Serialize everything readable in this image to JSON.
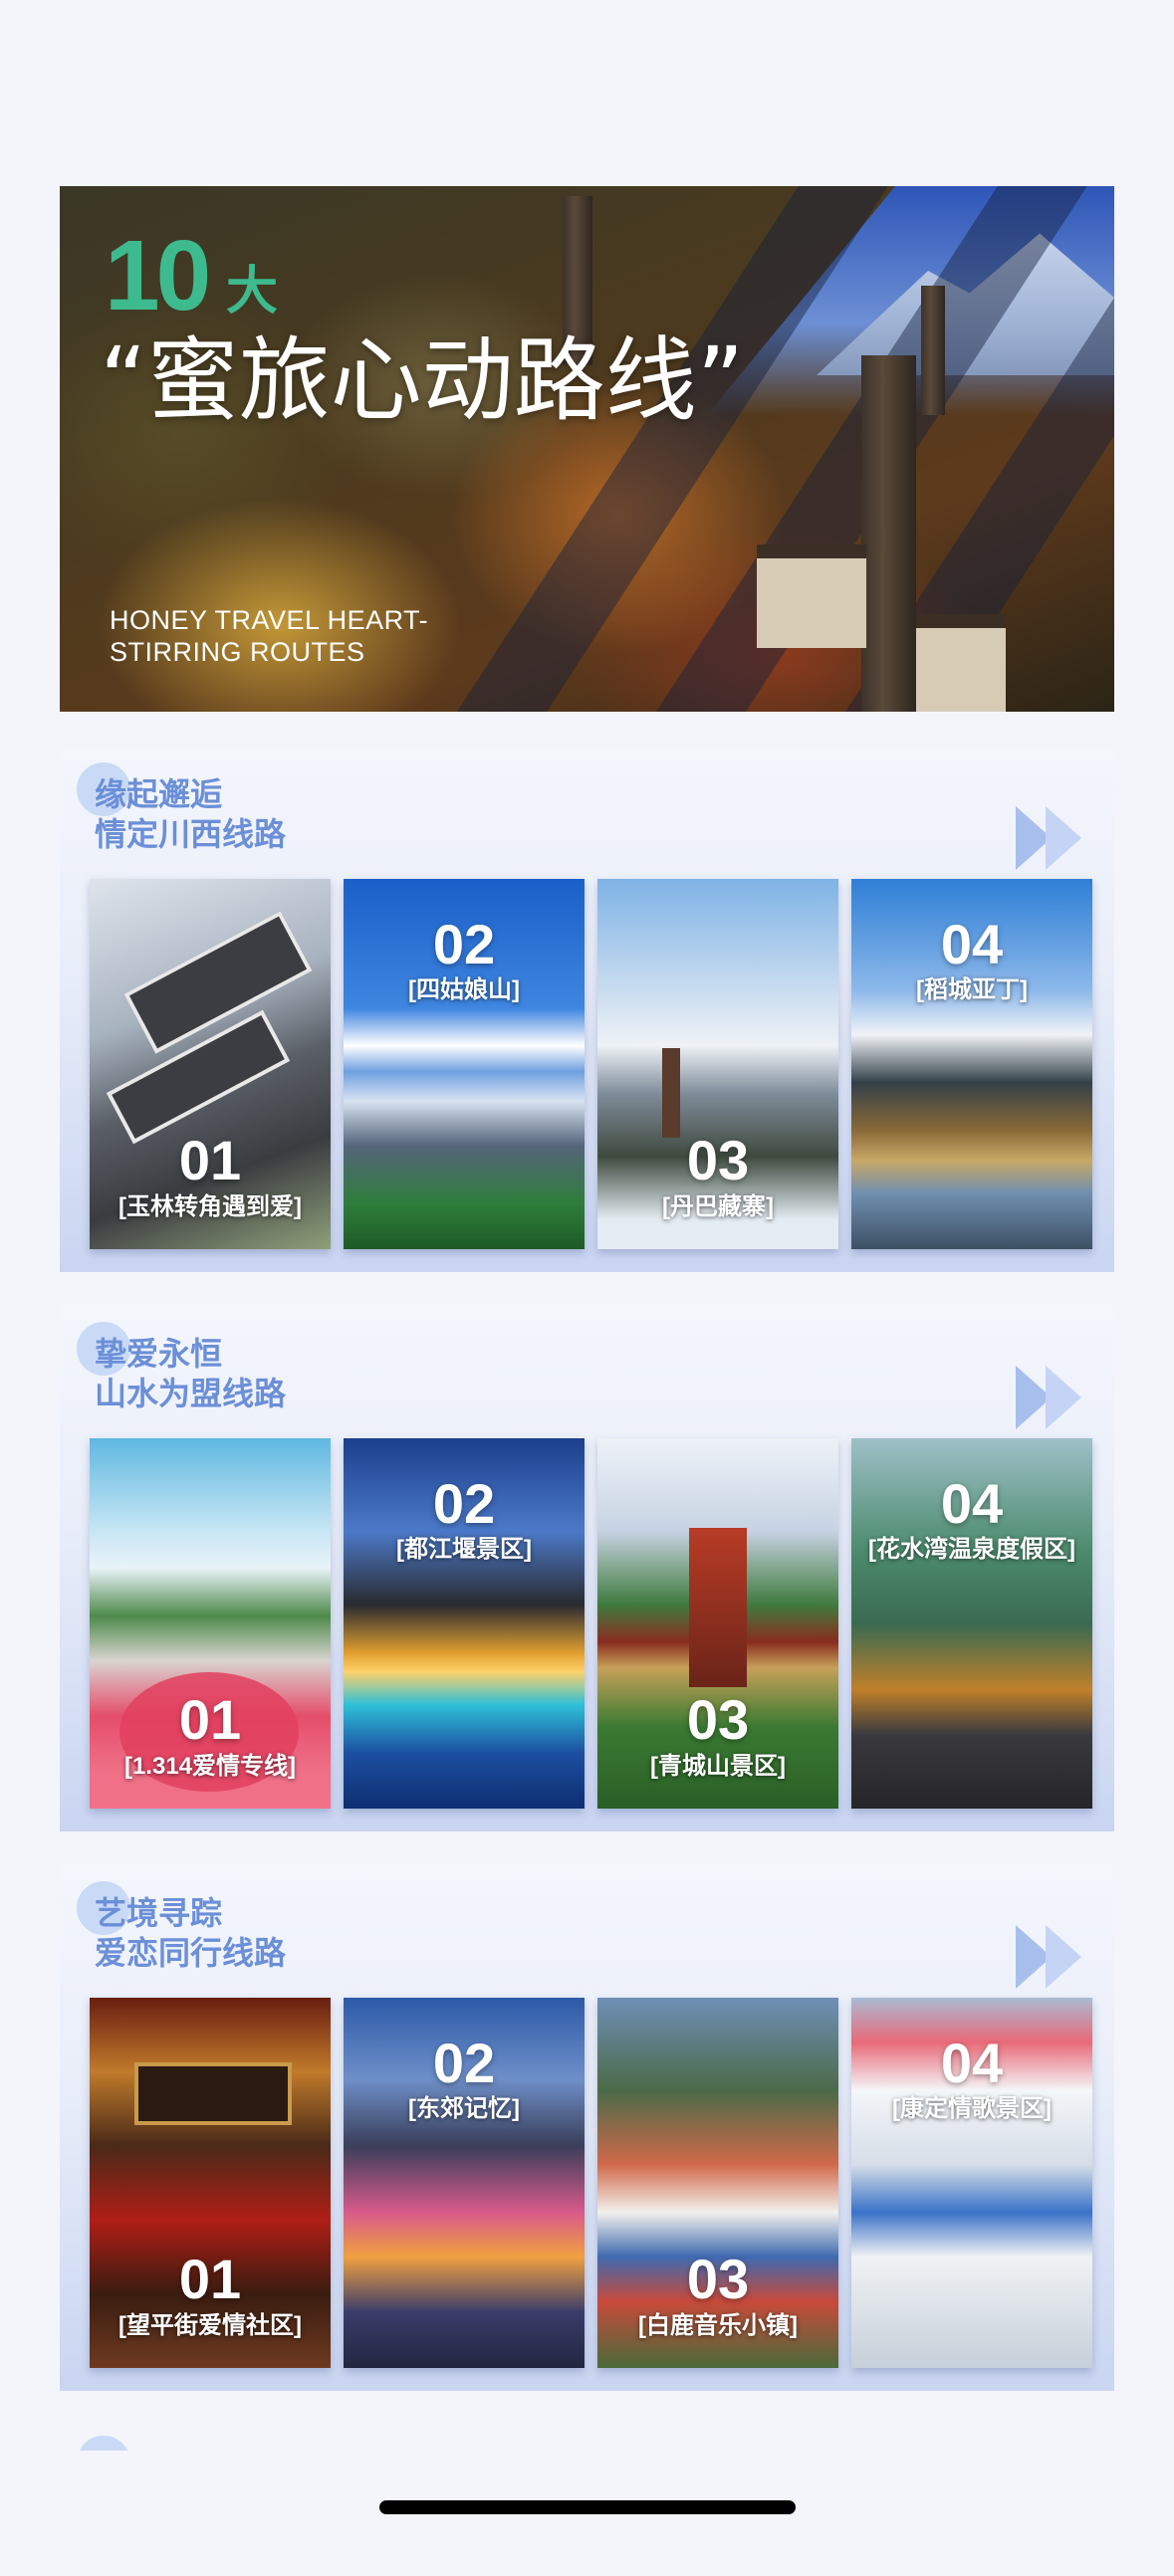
{
  "hero": {
    "number": "10",
    "number_suffix": "大",
    "title": "“蜜旅心动路线”",
    "subtitle": "HONEY TRAVEL HEART-STIRRING ROUTES"
  },
  "sections": [
    {
      "title_line1": "缘起邂逅",
      "title_line2": "情定川西线路",
      "cards": [
        {
          "num": "01",
          "caption": "[玉林转角遇到爱]"
        },
        {
          "num": "02",
          "caption": "[四姑娘山]"
        },
        {
          "num": "03",
          "caption": "[丹巴藏寨]"
        },
        {
          "num": "04",
          "caption": "[稻城亚丁]"
        }
      ]
    },
    {
      "title_line1": "挚爱永恒",
      "title_line2": "山水为盟线路",
      "cards": [
        {
          "num": "01",
          "caption": "[1.314爱情专线]"
        },
        {
          "num": "02",
          "caption": "[都江堰景区]"
        },
        {
          "num": "03",
          "caption": "[青城山景区]"
        },
        {
          "num": "04",
          "caption": "[花水湾温泉度假区]"
        }
      ]
    },
    {
      "title_line1": "艺境寻踪",
      "title_line2": "爱恋同行线路",
      "cards": [
        {
          "num": "01",
          "caption": "[望平街爱情社区]"
        },
        {
          "num": "02",
          "caption": "[东郊记忆]"
        },
        {
          "num": "03",
          "caption": "[白鹿音乐小镇]"
        },
        {
          "num": "04",
          "caption": "[康定情歌景区]"
        }
      ]
    }
  ],
  "colors": {
    "accent_green": "#3dbb8f",
    "section_title_blue": "#6b8fd8",
    "page_background": "#f3f5fb"
  }
}
